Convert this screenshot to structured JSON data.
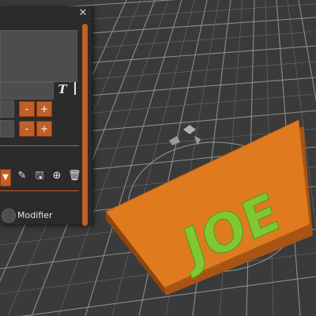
{
  "panel": {
    "close_label": "✕",
    "font_icon_glyph": "T",
    "row1": {
      "minus": "-",
      "plus": "+"
    },
    "row2": {
      "minus": "-",
      "plus": "+"
    },
    "dropdown_glyph": "▼",
    "tools": [
      "edit-icon",
      "save-icon",
      "add-icon",
      "delete-icon"
    ],
    "tool_glyphs": {
      "edit": "✎",
      "save": "🖫",
      "add": "⊕",
      "delete": "🗑"
    },
    "modifier_label": "Modifier"
  },
  "scene": {
    "plate_text": "JOE",
    "plate_color": "#e07a1f",
    "text_color": "#7fc832",
    "grid_bg": "#3a3a3a",
    "grid_line": "#8a8a8a",
    "accent": "#c25f26"
  }
}
